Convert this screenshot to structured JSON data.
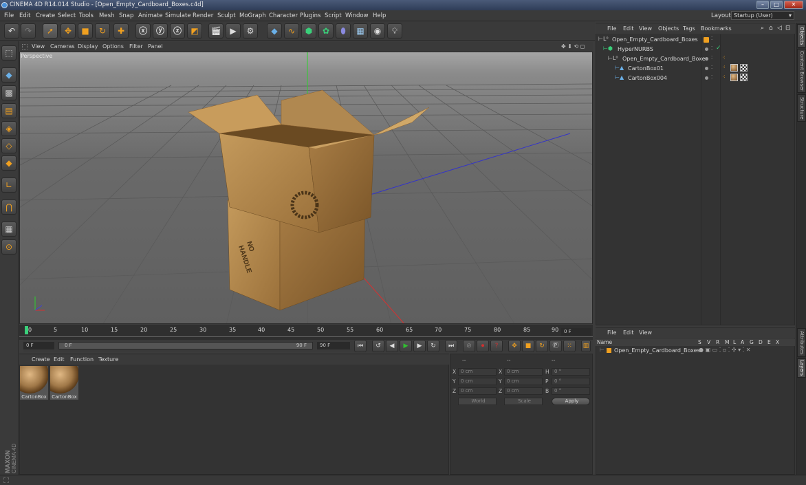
{
  "app": {
    "title": "CINEMA 4D R14.014 Studio - [Open_Empty_Cardboard_Boxes.c4d]",
    "layout_label": "Layout:",
    "layout_value": "Startup (User)"
  },
  "menubar": [
    "File",
    "Edit",
    "Create",
    "Select",
    "Tools",
    "Mesh",
    "Snap",
    "Animate",
    "Simulate",
    "Render",
    "Sculpt",
    "MoGraph",
    "Character",
    "Plugins",
    "Script",
    "Window",
    "Help"
  ],
  "viewport": {
    "menu": [
      "View",
      "Cameras",
      "Display",
      "Options",
      "Filter",
      "Panel"
    ],
    "label": "Perspective",
    "box_text_top": "NO",
    "box_text_bottom": "HANDLE"
  },
  "object_manager": {
    "menu": [
      "File",
      "Edit",
      "View",
      "Objects",
      "Tags",
      "Bookmarks"
    ],
    "items": [
      {
        "name": "Open_Empty_Cardboard_Boxes",
        "level": 0
      },
      {
        "name": "HyperNURBS",
        "level": 1
      },
      {
        "name": "Open_Empty_Cardboard_Boxes",
        "level": 2
      },
      {
        "name": "CartonBox01",
        "level": 3
      },
      {
        "name": "CartonBox004",
        "level": 3
      }
    ]
  },
  "timeline": {
    "ticks": [
      "0",
      "5",
      "10",
      "15",
      "20",
      "25",
      "30",
      "35",
      "40",
      "45",
      "50",
      "55",
      "60",
      "65",
      "70",
      "75",
      "80",
      "85",
      "90"
    ],
    "current_frame": "0 F",
    "start_field": "0 F",
    "range_start": "0 F",
    "range_end": "90 F",
    "end_field": "90 F"
  },
  "material_manager": {
    "menu": [
      "Create",
      "Edit",
      "Function",
      "Texture"
    ],
    "materials": [
      "CartonBox",
      "CartonBox"
    ]
  },
  "coordinates": {
    "header": [
      "--",
      "--",
      "--"
    ],
    "rows": [
      {
        "a": "X",
        "av": "0 cm",
        "b": "X",
        "bv": "0 cm",
        "c": "H",
        "cv": "0 °"
      },
      {
        "a": "Y",
        "av": "0 cm",
        "b": "Y",
        "bv": "0 cm",
        "c": "P",
        "cv": "0 °"
      },
      {
        "a": "Z",
        "av": "0 cm",
        "b": "Z",
        "bv": "0 cm",
        "c": "B",
        "cv": "0 °"
      }
    ],
    "mode": "World",
    "scale": "Scale",
    "apply": "Apply"
  },
  "layer_manager": {
    "menu": [
      "File",
      "Edit",
      "View"
    ],
    "columns": [
      "Name",
      "S",
      "V",
      "R",
      "M",
      "L",
      "A",
      "G",
      "D",
      "E",
      "X"
    ],
    "row": "Open_Empty_Cardboard_Boxes"
  },
  "right_tabs": [
    "Objects",
    "Content Browser",
    "Structure",
    "Attributes",
    "Layers"
  ],
  "brand": {
    "maxon": "MAXON",
    "c4d": "CINEMA 4D"
  },
  "colors": {
    "accent": "#f0a020",
    "play": "#30c030",
    "record": "#d03030",
    "axis_y": "#2bd12b",
    "axis_x": "#d83030",
    "axis_z": "#4040d8"
  }
}
